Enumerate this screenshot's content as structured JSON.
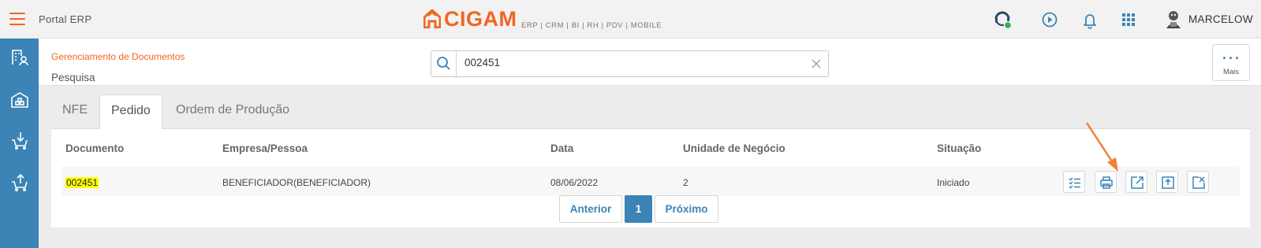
{
  "app": {
    "title": "Portal ERP",
    "logo_text": "CIGAM",
    "logo_sub": "ERP | CRM | BI | RH | PDV | MOBILE",
    "brand_color": "#f26522",
    "accent_color": "#3b84b5"
  },
  "topbar": {
    "icons": [
      "menu-icon",
      "support-agent-icon",
      "play-circle-icon",
      "bell-icon",
      "apps-grid-icon"
    ],
    "user_name": "MARCELOW",
    "status_color": "#2db34a"
  },
  "sidebar": {
    "items": [
      {
        "icon": "building-person-icon"
      },
      {
        "icon": "warehouse-icon"
      },
      {
        "icon": "cart-download-icon"
      },
      {
        "icon": "cart-upload-icon"
      }
    ]
  },
  "breadcrumb": "Gerenciamento de Documentos",
  "page_title": "Pesquisa",
  "search": {
    "value": "002451",
    "placeholder": ""
  },
  "more": {
    "dots": "···",
    "label": "Mais"
  },
  "tabs": [
    {
      "label": "NFE",
      "active": false
    },
    {
      "label": "Pedido",
      "active": true
    },
    {
      "label": "Ordem de Produção",
      "active": false
    }
  ],
  "table": {
    "columns": [
      "Documento",
      "Empresa/Pessoa",
      "Data",
      "Unidade de Negócio",
      "Situação"
    ],
    "rows": [
      {
        "documento": "002451",
        "empresa": "BENEFICIADOR(BENEFICIADOR)",
        "data": "08/06/2022",
        "unidade": "2",
        "situacao": "Iniciado",
        "actions": [
          "checklist-icon",
          "print-icon",
          "edit-export-icon",
          "upload-icon",
          "close-export-icon"
        ]
      }
    ]
  },
  "pagination": {
    "prev": "Anterior",
    "current": "1",
    "next": "Próximo"
  }
}
